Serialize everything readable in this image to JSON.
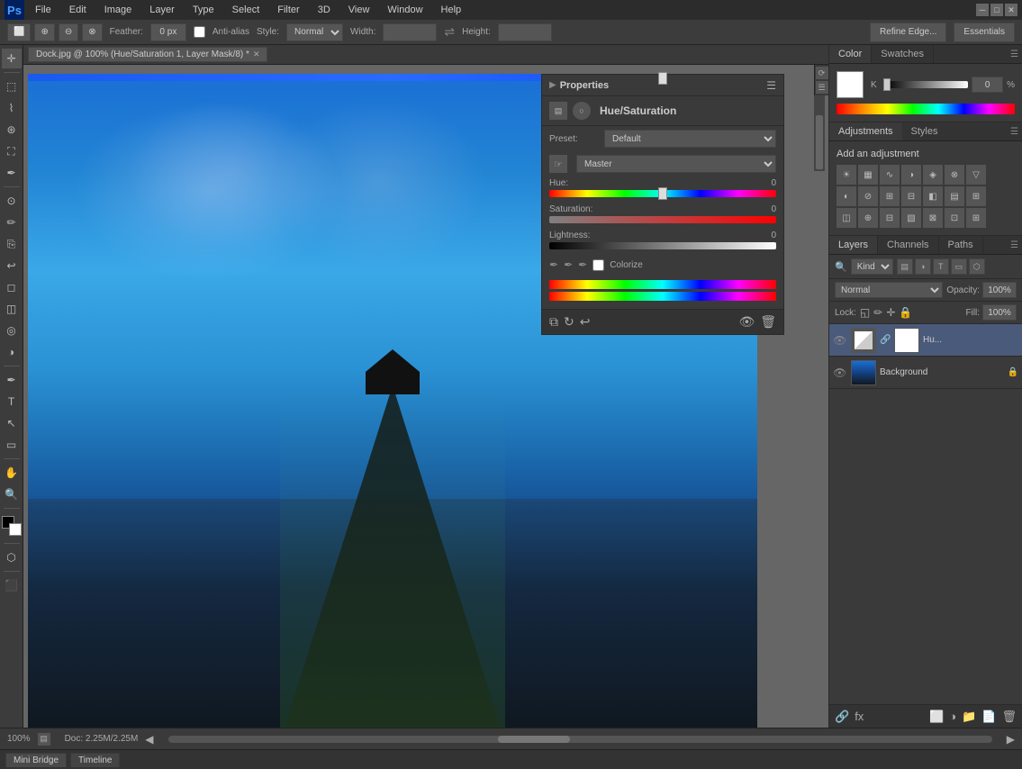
{
  "app": {
    "title": "Adobe Photoshop",
    "logo": "Ps"
  },
  "menu": {
    "items": [
      "File",
      "Edit",
      "Image",
      "Layer",
      "Type",
      "Select",
      "Filter",
      "3D",
      "View",
      "Window",
      "Help"
    ]
  },
  "options_bar": {
    "feather_label": "Feather:",
    "feather_value": "0 px",
    "anti_alias_label": "Anti-alias",
    "style_label": "Style:",
    "style_value": "Normal",
    "width_label": "Width:",
    "height_label": "Height:",
    "refine_edge": "Refine Edge...",
    "essentials": "Essentials"
  },
  "canvas": {
    "tab_title": "Dock.jpg @ 100% (Hue/Saturation 1, Layer Mask/8) *",
    "zoom": "100%",
    "doc_info": "Doc: 2.25M/2.25M"
  },
  "properties": {
    "title": "Properties",
    "adjustment_name": "Hue/Saturation",
    "preset_label": "Preset:",
    "preset_value": "Default",
    "channel_label": "Master",
    "hue_label": "Hue:",
    "hue_value": "0",
    "hue_position": "50",
    "saturation_label": "Saturation:",
    "saturation_value": "0",
    "saturation_position": "50",
    "lightness_label": "Lightness:",
    "lightness_value": "0",
    "lightness_position": "50",
    "colorize_label": "Colorize"
  },
  "color_panel": {
    "tab_color": "Color",
    "tab_swatches": "Swatches",
    "k_label": "K",
    "k_value": "0",
    "k_percent": "%"
  },
  "adjustments": {
    "tab_adjustments": "Adjustments",
    "tab_styles": "Styles",
    "title": "Add an adjustment"
  },
  "layers": {
    "tab_layers": "Layers",
    "tab_channels": "Channels",
    "tab_paths": "Paths",
    "kind_label": "Kind",
    "blend_mode": "Normal",
    "opacity_label": "Opacity:",
    "opacity_value": "100%",
    "lock_label": "Lock:",
    "fill_label": "Fill:",
    "fill_value": "100%",
    "items": [
      {
        "name": "Hu...",
        "type": "adjustment",
        "visible": true,
        "active": true
      },
      {
        "name": "Background",
        "type": "image",
        "visible": true,
        "locked": true,
        "active": false
      }
    ]
  },
  "bottom_bar": {
    "zoom": "100%",
    "doc_info": "Doc: 2.25M/2.25M"
  },
  "mini_bridge": {
    "tab1": "Mini Bridge",
    "tab2": "Timeline"
  }
}
